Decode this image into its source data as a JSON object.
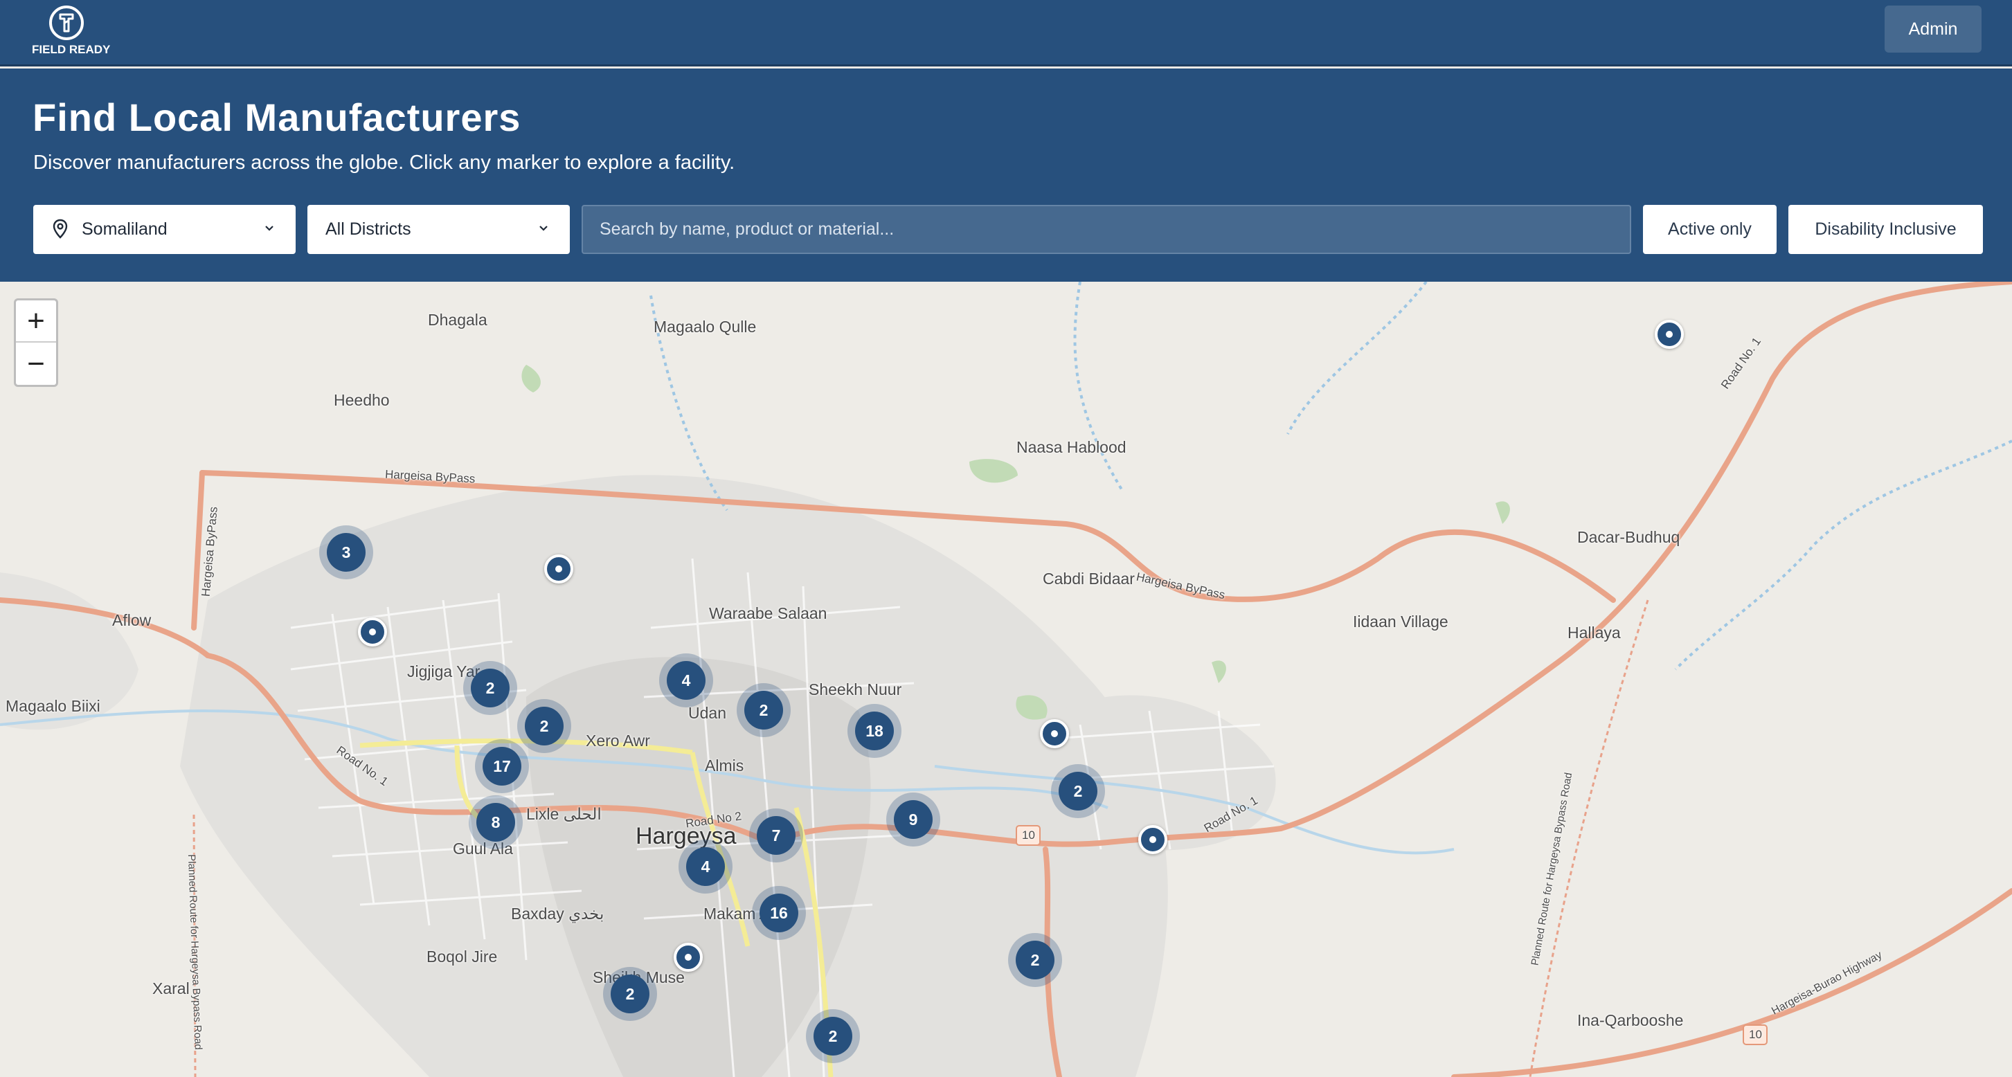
{
  "brand": {
    "logo_text": "FIELD READY",
    "logo_icon": "field-ready-badge-icon"
  },
  "topbar": {
    "admin_label": "Admin"
  },
  "header": {
    "title": "Find Local Manufacturers",
    "subtitle": "Discover manufacturers across the globe. Click any marker to explore a facility."
  },
  "filters": {
    "country": {
      "value": "Somaliland",
      "icon": "location-pin-icon"
    },
    "district": {
      "value": "All Districts"
    },
    "search": {
      "placeholder": "Search by name, product or material..."
    },
    "active_only_label": "Active only",
    "disability_inclusive_label": "Disability Inclusive"
  },
  "map": {
    "zoom_in": "+",
    "zoom_out": "−",
    "places": {
      "dhagala": "Dhagala",
      "magaalo_qulle": "Magaalo Qulle",
      "heedho": "Heedho",
      "naasa_hablood": "Naasa Hablood",
      "dacar_budhuq": "Dacar-Budhuq",
      "cabdi_bidaar": "Cabdi Bidaar",
      "aflow": "Aflow",
      "waraabe_salaan": "Waraabe Salaan",
      "iidaan_village": "Iidaan Village",
      "hallaya": "Hallaya",
      "magaalo_biixi": "Magaalo Biixi",
      "jigjiga_yar": "Jigjiga Yar",
      "udan": "Udan",
      "sheekh_nuur": "Sheekh Nuur",
      "xero_awr": "Xero Awr",
      "almis": "Almis",
      "lixle": "Lixle الحلى",
      "guul_ala": "Guul Ala",
      "hargeysa": "Hargeysa",
      "baxday": "Baxday بخدي",
      "makam_ali": "Makam Ali",
      "boqol_jire": "Boqol Jire",
      "xaral": "Xaral",
      "sheikh_muse": "Sheikh Muse",
      "ina_qarbooshe": "Ina-Qarbooshe",
      "road_hargeisa_bypass": "Hargeisa ByPass",
      "road_no1": "Road No. 1",
      "road_no2": "Road No 2",
      "road_planned": "Planned Route for Hargeysa Bypass Road",
      "road_burao": "Hargeisa-Burao Highway",
      "road_10": "10"
    },
    "clusters": [
      "3",
      "4",
      "2",
      "2",
      "18",
      "2",
      "17",
      "9",
      "8",
      "7",
      "2",
      "4",
      "16",
      "2",
      "2",
      "2"
    ]
  }
}
